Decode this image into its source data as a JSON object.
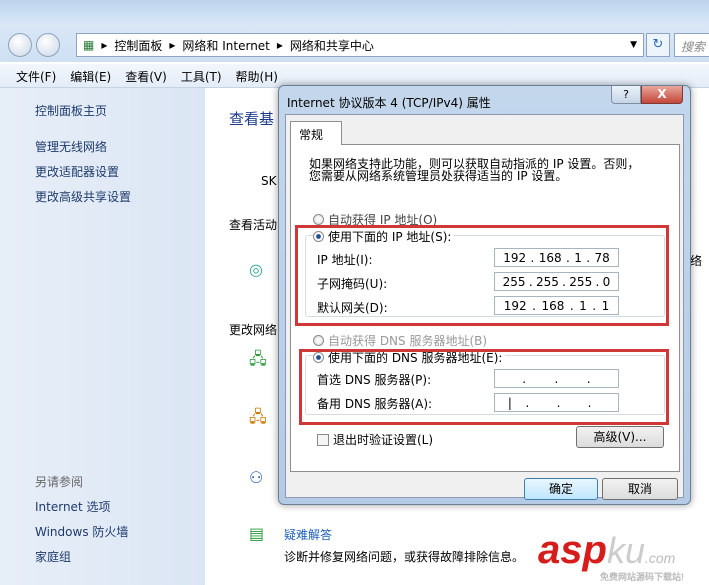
{
  "explorer": {
    "breadcrumb": [
      "控制面板",
      "网络和 Internet",
      "网络和共享中心"
    ],
    "search_placeholder": "搜索"
  },
  "menu": [
    "文件(F)",
    "编辑(E)",
    "查看(V)",
    "工具(T)",
    "帮助(H)"
  ],
  "sidebar": {
    "home": "控制面板主页",
    "links": [
      "管理无线网络",
      "更改适配器设置",
      "更改高级共享设置"
    ],
    "see_also_title": "另请参阅",
    "see_also": [
      "Internet 选项",
      "Windows 防火墙",
      "家庭组"
    ]
  },
  "main": {
    "heading": "查看基",
    "sky": "SK",
    "active": "查看活动",
    "change": "更改网络",
    "troubleshoot": "疑难解答",
    "troubleshoot_desc": "诊断并修复网络问题，或获得故障排除信息。",
    "right_fragment": "络"
  },
  "dialog": {
    "title": "Internet 协议版本 4 (TCP/IPv4) 属性",
    "help": "?",
    "close": "X",
    "tab": "常规",
    "desc_line1": "如果网络支持此功能，则可以获取自动指派的 IP 设置。否则，",
    "desc_line2": "您需要从网络系统管理员处获得适当的 IP 设置。",
    "auto_ip": "自动获得 IP 地址(O)",
    "manual_ip": "使用下面的 IP 地址(S):",
    "ip_label": "IP 地址(I):",
    "ip": [
      "192",
      "168",
      "1",
      "78"
    ],
    "mask_label": "子网掩码(U):",
    "mask": [
      "255",
      "255",
      "255",
      "0"
    ],
    "gw_label": "默认网关(D):",
    "gw": [
      "192",
      "168",
      "1",
      "1"
    ],
    "auto_dns": "自动获得 DNS 服务器地址(B)",
    "manual_dns": "使用下面的 DNS 服务器地址(E):",
    "dns1_label": "首选 DNS 服务器(P):",
    "dns2_label": "备用 DNS 服务器(A):",
    "validate": "退出时验证设置(L)",
    "advanced": "高级(V)...",
    "ok": "确定",
    "cancel": "取消"
  },
  "watermark": {
    "brand": "asp",
    "brand2": "ku",
    "tld": ".com",
    "slogan": "免费网站源码下载站!"
  }
}
